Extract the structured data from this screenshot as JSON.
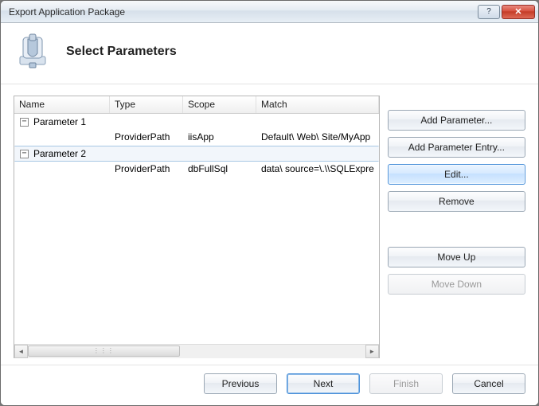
{
  "window": {
    "title": "Export Application Package"
  },
  "header": {
    "heading": "Select Parameters"
  },
  "grid": {
    "columns": {
      "name": "Name",
      "type": "Type",
      "scope": "Scope",
      "match": "Match"
    },
    "rows": [
      {
        "name": "Parameter 1",
        "expanded": true,
        "detail": {
          "type": "ProviderPath",
          "scope": "iisApp",
          "match": "Default\\ Web\\ Site/MyApp"
        }
      },
      {
        "name": "Parameter 2",
        "expanded": true,
        "selected": true,
        "detail": {
          "type": "ProviderPath",
          "scope": "dbFullSql",
          "match": "data\\ source=\\.\\\\SQLExpre"
        }
      }
    ]
  },
  "side": {
    "add_parameter": "Add Parameter...",
    "add_parameter_entry": "Add Parameter Entry...",
    "edit": "Edit...",
    "remove": "Remove",
    "move_up": "Move Up",
    "move_down": "Move Down"
  },
  "footer": {
    "previous": "Previous",
    "next": "Next",
    "finish": "Finish",
    "cancel": "Cancel"
  },
  "glyphs": {
    "minus": "−",
    "left": "◄",
    "right": "►",
    "thumb": "⋮⋮⋮",
    "help": "?",
    "close": "✕"
  }
}
